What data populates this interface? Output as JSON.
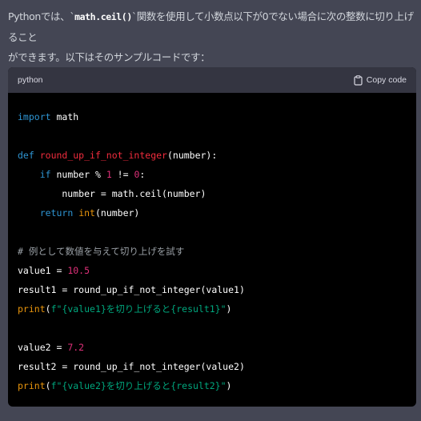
{
  "intro": {
    "line1_before": "Pythonでは、`",
    "inline_code": "math.ceil()",
    "line1_after": "`関数を使用して小数点以下が0でない場合に次の整数に切り上げること",
    "line2": "ができます。以下はそのサンプルコードです："
  },
  "code_block": {
    "language": "python",
    "copy_label": "Copy code",
    "copy_icon": "clipboard-icon"
  },
  "code_lines": [
    [
      {
        "t": "import",
        "c": "kw"
      },
      {
        "t": " math",
        "c": "pl"
      }
    ],
    [],
    [
      {
        "t": "def",
        "c": "kw"
      },
      {
        "t": " ",
        "c": "pl"
      },
      {
        "t": "round_up_if_not_integer",
        "c": "fn"
      },
      {
        "t": "(number):",
        "c": "pl"
      }
    ],
    [
      {
        "t": "    ",
        "c": "pl"
      },
      {
        "t": "if",
        "c": "kw"
      },
      {
        "t": " number % ",
        "c": "pl"
      },
      {
        "t": "1",
        "c": "num"
      },
      {
        "t": " != ",
        "c": "pl"
      },
      {
        "t": "0",
        "c": "num"
      },
      {
        "t": ":",
        "c": "pl"
      }
    ],
    [
      {
        "t": "        number = math.ceil(number)",
        "c": "pl"
      }
    ],
    [
      {
        "t": "    ",
        "c": "pl"
      },
      {
        "t": "return",
        "c": "kw"
      },
      {
        "t": " ",
        "c": "pl"
      },
      {
        "t": "int",
        "c": "bi"
      },
      {
        "t": "(number)",
        "c": "pl"
      }
    ],
    [],
    [
      {
        "t": "# 例として数値を与えて切り上げを試す",
        "c": "cm"
      }
    ],
    [
      {
        "t": "value1 = ",
        "c": "pl"
      },
      {
        "t": "10.5",
        "c": "num"
      }
    ],
    [
      {
        "t": "result1 = round_up_if_not_integer(value1)",
        "c": "pl"
      }
    ],
    [
      {
        "t": "print",
        "c": "bi"
      },
      {
        "t": "(",
        "c": "pl"
      },
      {
        "t": "f\"{value1}を切り上げると{result1}\"",
        "c": "str"
      },
      {
        "t": ")",
        "c": "pl"
      }
    ],
    [],
    [
      {
        "t": "value2 = ",
        "c": "pl"
      },
      {
        "t": "7.2",
        "c": "num"
      }
    ],
    [
      {
        "t": "result2 = round_up_if_not_integer(value2)",
        "c": "pl"
      }
    ],
    [
      {
        "t": "print",
        "c": "bi"
      },
      {
        "t": "(",
        "c": "pl"
      },
      {
        "t": "f\"{value2}を切り上げると{result2}\"",
        "c": "str"
      },
      {
        "t": ")",
        "c": "pl"
      }
    ]
  ],
  "colors": {
    "page_bg": "#444654",
    "code_bg": "#000000",
    "header_bg": "#343541",
    "keyword": "#2e95d3",
    "function_name": "#f22c3d",
    "number": "#df3079",
    "builtin": "#e9950c",
    "string": "#00a67d",
    "comment": "#9aa0a6"
  }
}
